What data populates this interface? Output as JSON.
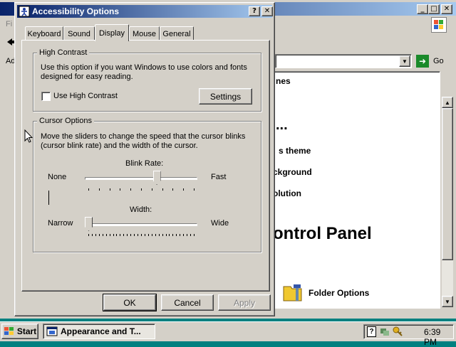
{
  "background_window": {
    "menu_fragment": "Fi",
    "address_fragment": "Ad",
    "go_label": "Go",
    "content": [
      "nes",
      "...",
      "s theme",
      "ckground",
      "olution",
      "ontrol Panel",
      "Folder Options"
    ]
  },
  "dialog": {
    "title": "Accessibility Options",
    "title_buttons": {
      "help": "?",
      "close": "✕"
    },
    "tabs": [
      "Keyboard",
      "Sound",
      "Display",
      "Mouse",
      "General"
    ],
    "active_tab": "Display",
    "high_contrast": {
      "group_label": "High Contrast",
      "description": "Use this option if you want Windows to use colors and fonts designed for easy reading.",
      "checkbox_label": "Use High Contrast",
      "checked": false,
      "settings_button": "Settings"
    },
    "cursor_options": {
      "group_label": "Cursor Options",
      "description": "Move the sliders to change the speed that the cursor blinks (cursor blink rate) and the width of the cursor.",
      "blink_rate": {
        "label": "Blink Rate:",
        "min_label": "None",
        "max_label": "Fast",
        "value_fraction": 0.65
      },
      "width": {
        "label": "Width:",
        "min_label": "Narrow",
        "max_label": "Wide",
        "value_fraction": 0.0
      }
    },
    "buttons": {
      "ok": "OK",
      "cancel": "Cancel",
      "apply": "Apply"
    }
  },
  "taskbar": {
    "start_label": "Start",
    "task_label": "Appearance and T...",
    "clock": "6:39 PM"
  },
  "colors": {
    "titlebar_start": "#0a246a",
    "titlebar_end": "#a6caf0",
    "face": "#d4d0c8"
  }
}
